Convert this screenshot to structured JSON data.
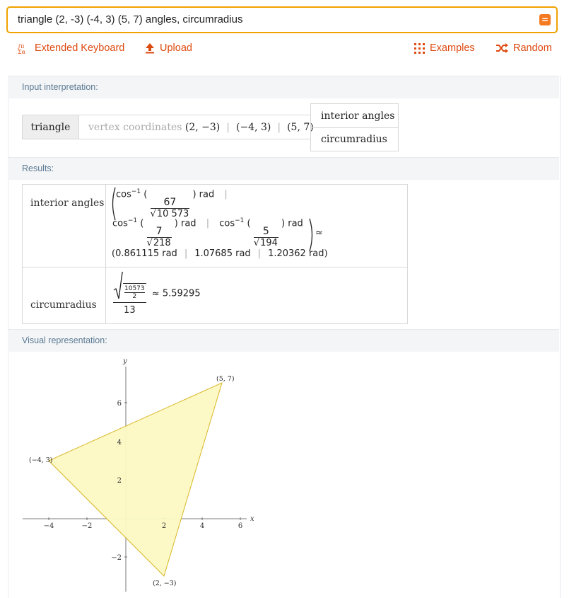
{
  "search": {
    "query": "triangle (2, -3) (-4, 3) (5, 7) angles, circumradius",
    "submit_label": "="
  },
  "toolbar": {
    "extended_keyboard": "Extended Keyboard",
    "upload": "Upload",
    "examples": "Examples",
    "random": "Random"
  },
  "input_interpretation": {
    "title": "Input interpretation:",
    "object": "triangle",
    "attribute_label": "vertex coordinates",
    "vertices": [
      "(2, −3)",
      "(−4, 3)",
      "(5, 7)"
    ],
    "properties": [
      "interior angles",
      "circumradius"
    ]
  },
  "results": {
    "title": "Results:",
    "interior_angles": {
      "label": "interior angles",
      "exact": [
        {
          "func": "cos",
          "sup": "−1",
          "num": "67",
          "den_sqrt": "10 573",
          "unit": "rad"
        },
        {
          "func": "cos",
          "sup": "−1",
          "num": "7",
          "den_sqrt": "218",
          "unit": "rad"
        },
        {
          "func": "cos",
          "sup": "−1",
          "num": "5",
          "den_sqrt": "194",
          "unit": "rad"
        }
      ],
      "approx_symbol": "≈",
      "approx": [
        "0.861115 rad",
        "1.07685 rad",
        "1.20362 rad"
      ]
    },
    "circumradius": {
      "label": "circumradius",
      "sqrt_num": "10573",
      "sqrt_den": "2",
      "den": "13",
      "approx_symbol": "≈",
      "approx": "5.59295"
    }
  },
  "visual": {
    "title": "Visual representation:",
    "x_axis_label": "x",
    "y_axis_label": "y",
    "x_ticks": [
      "−4",
      "−2",
      "2",
      "4",
      "6"
    ],
    "y_ticks": [
      "6",
      "4",
      "2",
      "−2"
    ],
    "vertex_labels": [
      "(5, 7)",
      "(−4, 3)",
      "(2, −3)"
    ],
    "fill_color": "#fcf9c3",
    "stroke_color": "#d9b627"
  },
  "colors": {
    "accent": "#dd4a10",
    "search_border": "#f0a200",
    "pod_header_bg": "#f3f5f7",
    "pod_title": "#5d7a93"
  }
}
